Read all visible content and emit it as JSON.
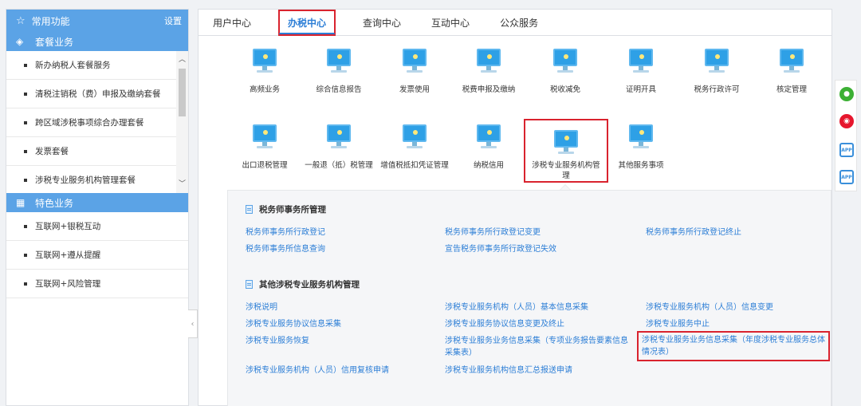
{
  "sidebar": {
    "header": {
      "title": "常用功能",
      "settings": "设置"
    },
    "group1": {
      "title": "套餐业务"
    },
    "packages": [
      {
        "label": "新办纳税人套餐服务"
      },
      {
        "label": "清税注销税（费）申报及缴纳套餐"
      },
      {
        "label": "跨区域涉税事项综合办理套餐"
      },
      {
        "label": "发票套餐"
      },
      {
        "label": "涉税专业服务机构管理套餐"
      }
    ],
    "group2": {
      "title": "特色业务"
    },
    "features": [
      {
        "label": "互联网+银税互动"
      },
      {
        "label": "互联网+遵从提醒"
      },
      {
        "label": "互联网+风险管理"
      }
    ]
  },
  "tabs": [
    {
      "label": "用户中心"
    },
    {
      "label": "办税中心"
    },
    {
      "label": "查询中心"
    },
    {
      "label": "互动中心"
    },
    {
      "label": "公众服务"
    }
  ],
  "icons": [
    {
      "label": "高频业务"
    },
    {
      "label": "综合信息报告"
    },
    {
      "label": "发票使用"
    },
    {
      "label": "税费申报及缴纳"
    },
    {
      "label": "税收减免"
    },
    {
      "label": "证明开具"
    },
    {
      "label": "税务行政许可"
    },
    {
      "label": "核定管理"
    },
    {
      "label": "出口退税管理"
    },
    {
      "label": "一般退（抵）税管理"
    },
    {
      "label": "增值税抵扣凭证管理"
    },
    {
      "label": "纳税信用"
    },
    {
      "label": "涉税专业服务机构管理"
    },
    {
      "label": "其他服务事项"
    }
  ],
  "panel": {
    "section1": {
      "title": "税务师事务所管理",
      "links": [
        "税务师事务所行政登记",
        "税务师事务所行政登记变更",
        "税务师事务所行政登记终止",
        "税务师事务所信息查询",
        "宣告税务师事务所行政登记失效"
      ]
    },
    "section2": {
      "title": "其他涉税专业服务机构管理",
      "links": [
        "涉税说明",
        "涉税专业服务机构（人员）基本信息采集",
        "涉税专业服务机构（人员）信息变更",
        "涉税专业服务协议信息采集",
        "涉税专业服务协议信息变更及终止",
        "涉税专业服务中止",
        "涉税专业服务恢复",
        "涉税专业服务业务信息采集（专项业务报告要素信息采集表）",
        "涉税专业服务业务信息采集（年度涉税专业服务总体情况表）",
        "涉税专业服务机构（人员）信用复核申请",
        "涉税专业服务机构信息汇总报送申请"
      ]
    }
  },
  "floatbar": {
    "app_label": "APP"
  },
  "colors": {
    "accent": "#5ba3e6",
    "link": "#2c7ed6",
    "highlight": "#d9232e"
  },
  "icon_names": [
    "star-icon",
    "package-icon",
    "grid-icon",
    "monitor-icon",
    "wechat-icon",
    "weibo-icon",
    "app-icon"
  ]
}
